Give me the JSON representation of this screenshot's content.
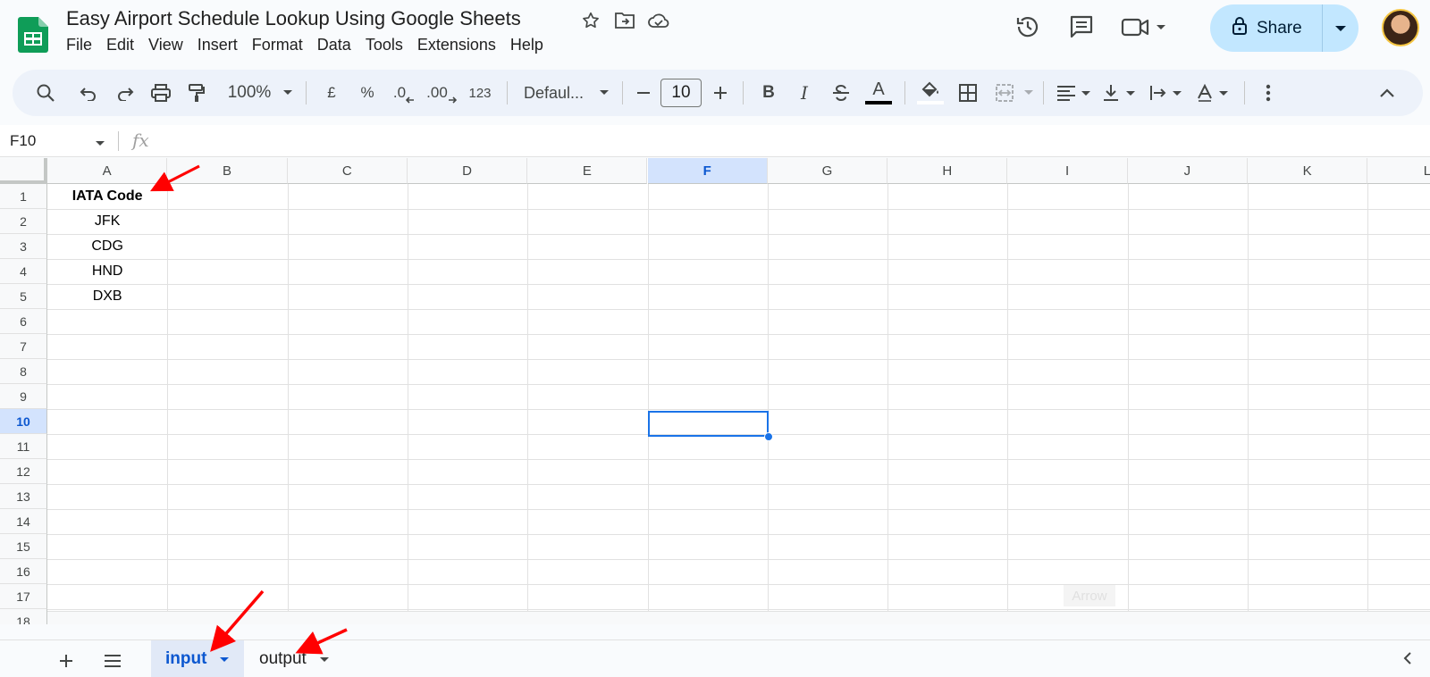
{
  "doc": {
    "title": "Easy Airport Schedule Lookup Using Google Sheets"
  },
  "menu": [
    "File",
    "Edit",
    "View",
    "Insert",
    "Format",
    "Data",
    "Tools",
    "Extensions",
    "Help"
  ],
  "share": {
    "label": "Share"
  },
  "toolbar": {
    "zoom": "100%",
    "currency": "£",
    "percent": "%",
    "dec_decrease": ".0",
    "dec_increase": ".00",
    "number_format": "123",
    "font": "Defaul...",
    "font_size": "10",
    "bold": "B",
    "italic": "I",
    "text_color": "A"
  },
  "formula_bar": {
    "name_box": "F10",
    "fx": "fx"
  },
  "grid": {
    "columns": [
      "A",
      "B",
      "C",
      "D",
      "E",
      "F",
      "G",
      "H",
      "I",
      "J",
      "K",
      "L"
    ],
    "rows": [
      "1",
      "2",
      "3",
      "4",
      "5",
      "6",
      "7",
      "8",
      "9",
      "10",
      "11",
      "12",
      "13",
      "14",
      "15",
      "16",
      "17",
      "18"
    ],
    "selected_column": "F",
    "selected_row": "10",
    "cells": {
      "A1": "IATA Code",
      "A2": "JFK",
      "A3": "CDG",
      "A4": "HND",
      "A5": "DXB"
    },
    "tooltip": "Arrow"
  },
  "sheets": [
    {
      "name": "input",
      "active": true
    },
    {
      "name": "output",
      "active": false
    }
  ],
  "colors": {
    "accent": "#0b57d0",
    "share_bg": "#c2e7ff",
    "toolbar_bg": "#edf2fa",
    "selection": "#1a73e8",
    "annotation": "#ff0000"
  }
}
